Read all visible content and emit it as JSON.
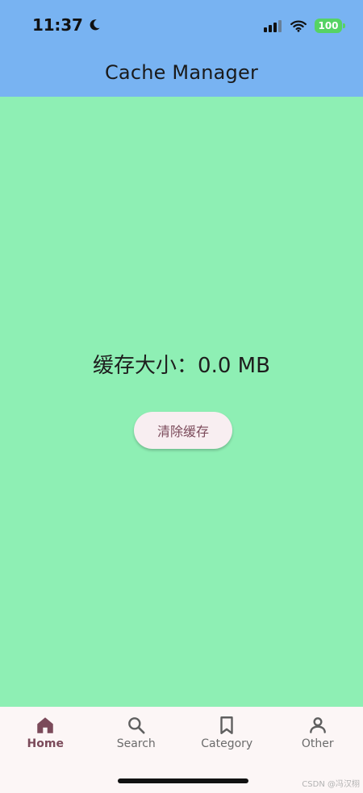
{
  "status_bar": {
    "time": "11:37",
    "battery": "100",
    "icons": [
      "moon-icon",
      "signal-icon",
      "wifi-icon",
      "battery-icon"
    ]
  },
  "app_bar": {
    "title": "Cache Manager"
  },
  "main": {
    "cache_size_text": "缓存大小：0.0 MB",
    "clear_button_label": "清除缓存"
  },
  "bottom_nav": {
    "active": "Home",
    "items": [
      {
        "label": "Home",
        "icon": "home-icon"
      },
      {
        "label": "Search",
        "icon": "search-icon"
      },
      {
        "label": "Category",
        "icon": "bookmark-icon"
      },
      {
        "label": "Other",
        "icon": "person-icon"
      }
    ]
  },
  "watermark": "CSDN @冯汉栩",
  "colors": {
    "app_bar": "#78B3F2",
    "background": "#8EEFB4",
    "button_bg": "#F8EEF1",
    "accent": "#7B4A5A",
    "nav_bg": "#FCF6F6",
    "battery": "#56D364"
  }
}
